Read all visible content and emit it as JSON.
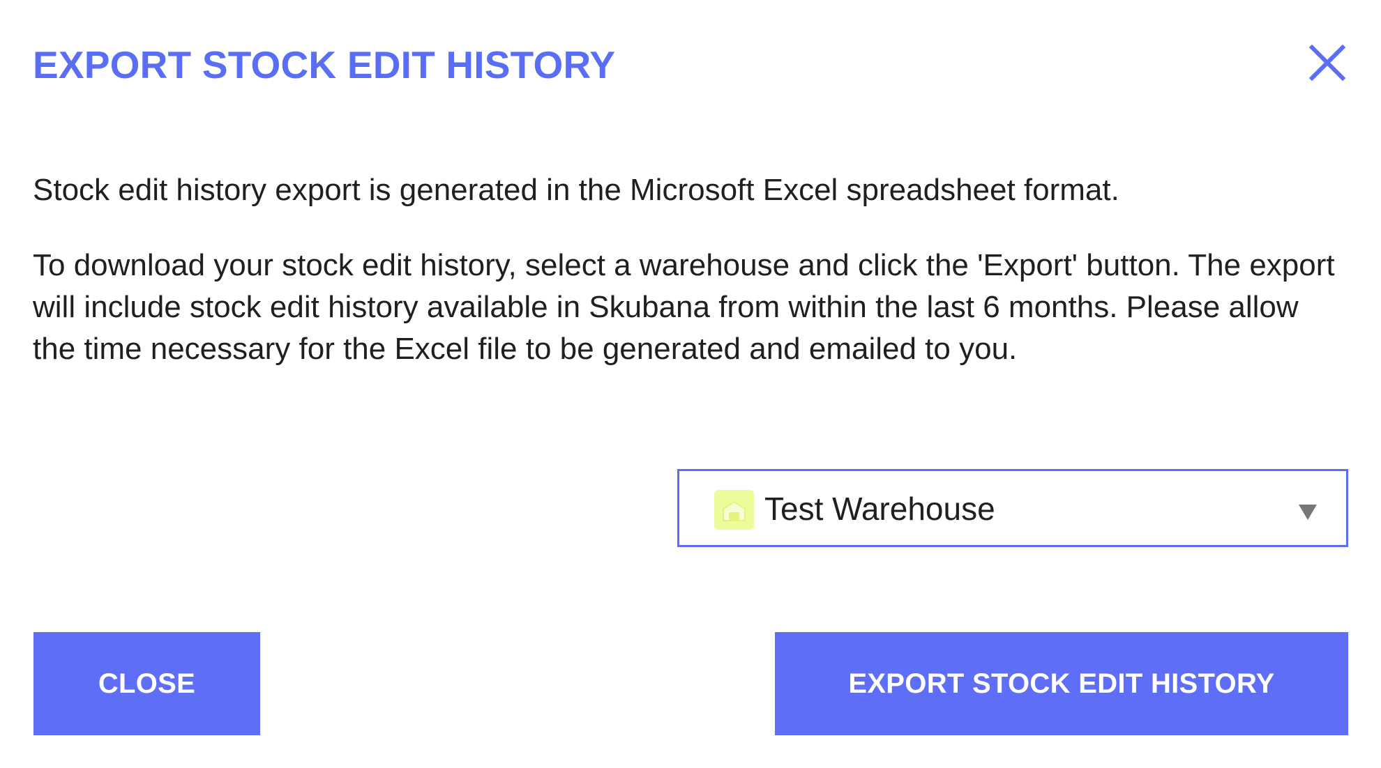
{
  "dialog": {
    "title": "EXPORT STOCK EDIT HISTORY",
    "close_icon": "close-icon",
    "description_1": "Stock edit history export is generated in the Microsoft Excel spreadsheet format.",
    "description_2": "To download your stock edit history, select a warehouse and click the 'Export' button. The export will include stock edit history available in Skubana from within the last 6 months. Please allow the time necessary for the Excel file to be generated and emailed to you."
  },
  "warehouse_select": {
    "icon": "warehouse-icon",
    "selected": "Test Warehouse",
    "caret_icon": "caret-down-icon"
  },
  "buttons": {
    "close_label": "CLOSE",
    "export_label": "EXPORT STOCK EDIT HISTORY"
  },
  "colors": {
    "accent": "#5a6ef5",
    "button_bg": "#5f6ef6",
    "warehouse_icon_bg": "#eefb9a",
    "text": "#1f1f23"
  }
}
